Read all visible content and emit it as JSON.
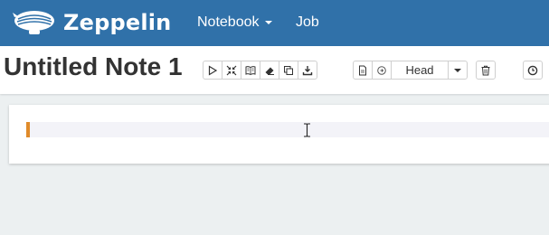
{
  "navbar": {
    "brand": "Zeppelin",
    "menu": [
      {
        "label": "Notebook",
        "has_dropdown": true
      },
      {
        "label": "Job",
        "has_dropdown": false
      }
    ]
  },
  "note": {
    "title": "Untitled Note 1",
    "toolbar": {
      "run_buttons": [
        "run-all-icon",
        "collapse-icon",
        "book-icon",
        "eraser-icon",
        "clone-icon",
        "download-icon"
      ],
      "version_buttons": [
        "commit-icon",
        "revision-icon"
      ],
      "revision_label": "Head",
      "extra_buttons": [
        "trash-icon",
        "clock-icon"
      ]
    }
  },
  "paragraph": {
    "text": ""
  },
  "colors": {
    "navbar": "#3071a9",
    "marker": "#e08b2a",
    "background": "#ecf0f1"
  }
}
